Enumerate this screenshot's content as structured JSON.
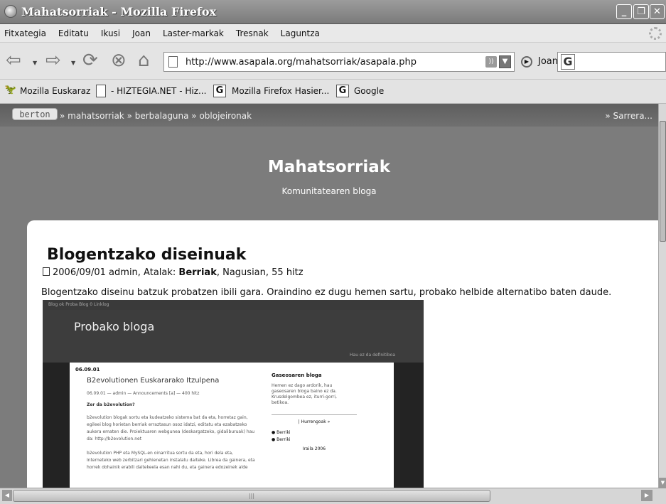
{
  "window": {
    "title": "Mahatsorriak - Mozilla Firefox"
  },
  "menu": [
    "Fitxategia",
    "Editatu",
    "Ikusi",
    "Joan",
    "Laster-markak",
    "Tresnak",
    "Laguntza"
  ],
  "navigation": {
    "url": "http://www.asapala.org/mahatsorriak/asapala.php",
    "go_label": "Joan"
  },
  "bookmarks": [
    "Mozilla Euskaraz",
    "- HIZTEGIA.NET - Hiz...",
    "Mozilla Firefox Hasier...",
    "Google"
  ],
  "site": {
    "logo": "berton",
    "breadcrumb": "» mahatsorriak » berbalaguna » oblojeironak",
    "sarrera": "» Sarrera...",
    "title": "Mahatsorriak",
    "tagline": "Komunitatearen bloga"
  },
  "post": {
    "title": "Blogentzako diseinuak",
    "meta_prefix": "2006/09/01 admin, Atalak:",
    "meta_category": "Berriak",
    "meta_suffix": ", Nagusian, 55 hitz",
    "text": "Blogentzako diseinu batzuk probatzen ibili gara. Oraindino ez dugu hemen sartu, probako helbide alternatibo baten daude."
  },
  "embedded_screenshot": {
    "top_links": "Blog ok   Proba   Blog 0   Linklog",
    "title": "Probako bloga",
    "header_note": "Hau ez da definitiboa",
    "date": "06.09.01",
    "post_title": "B2evolutionen Euskararako Itzulpena",
    "post_meta": "06.09.01 — admin — Announcements [a] — 400 hitz",
    "heading": "Zer da b2evolution?",
    "para1_line1": "b2evolution blogak sortu eta kudeatzeko sistema bat da eta, horretaz gain,",
    "para1_line2": "egileei blog horietan berriak erraztasun osoz idatzi, editatu eta ezabatzeko",
    "para1_line3": "aukera ematen die. Proiektuaren webgunea (deskargatzeko, gidaliburuak) hau",
    "para1_line4": "da: http://b2evolution.net",
    "para2_line1": "b2evolution PHP eta MySQL-en oinarritua sortu da eta, hori dela eta,",
    "para2_line2": "Interneteko web zerbitzari gehienetan instalatu daiteke. Librea da gainera, eta",
    "para2_line3": "horrek dohainik erabili daitekeela esan nahi du, eta gainera edozeinek alde",
    "side_heading": "Gaseosaren bloga",
    "side_text": "Hemen ez dago ardorik, hau gaseosaren bloga baino ez da. Krusdelgombea ez, iturri-gorri, betikoa.",
    "box_title": "| Hurrengoak »",
    "box_item1": "Berriki",
    "box_item2": "Berriki",
    "box_month": "Iraila 2006"
  }
}
